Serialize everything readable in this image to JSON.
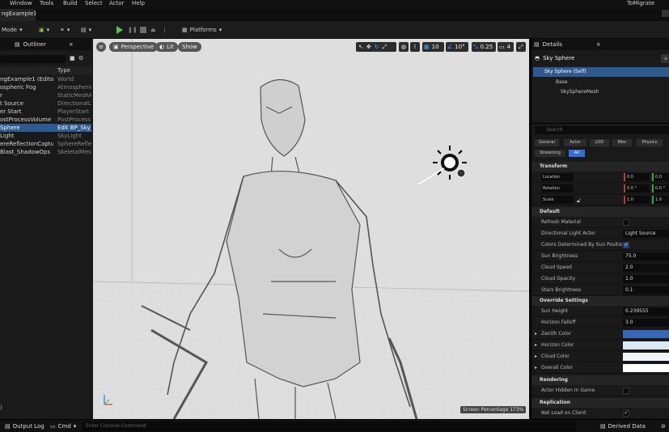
{
  "menu": [
    "Window",
    "Tools",
    "Build",
    "Select",
    "Actor",
    "Help"
  ],
  "project_label": "ToMigrate",
  "doc_tab": "ngExample1•",
  "toolbar": {
    "mode_label": "Mode",
    "platforms_label": "Platforms"
  },
  "outliner": {
    "title": "Outliner",
    "col_type": "Type",
    "rows": [
      {
        "name": "ngExample1 (Editor)",
        "type": "World"
      },
      {
        "name": "ospheric Fog",
        "type": "Atmospheric"
      },
      {
        "name": "r",
        "type": "StaticMeshAc"
      },
      {
        "name": "t Source",
        "type": "DirectionalLi"
      },
      {
        "name": "er Start",
        "type": "PlayerStart"
      },
      {
        "name": "ostProcessVolume",
        "type": "PostProcess"
      },
      {
        "name": "Sphere",
        "type": "Edit BP_Sky_",
        "selected": true
      },
      {
        "name": "Light",
        "type": "SkyLight"
      },
      {
        "name": "ereReflectionCapture",
        "type": "SphereReflec"
      },
      {
        "name": "Blast_ShadowOps",
        "type": "SkeletalMes"
      }
    ],
    "footer": ")"
  },
  "viewport": {
    "perspective": "Perspective",
    "lit": "Lit",
    "show": "Show",
    "grid_snap": "10",
    "rot_snap": "10°",
    "scale_snap": "0.25",
    "cam_speed": "4",
    "screen_percentage": "Screen Percentage  173%"
  },
  "details": {
    "title": "Details",
    "actor_name": "Sky Sphere",
    "components": [
      "Sky Sphere (Self)",
      "Base",
      "SkySphereMesh"
    ],
    "search_placeholder": "Search",
    "filter_tabs": [
      "General",
      "Actor",
      "LOD",
      "Misc",
      "Physics",
      "Streaming",
      "All"
    ],
    "transform": {
      "section": "Transform",
      "location": "Location",
      "rotation": "Rotation",
      "scale": "Scale",
      "loc_x": "0.0",
      "loc_y": "0.0",
      "rot_x": "0.0 °",
      "rot_y": "0.0 °",
      "scale_x": "1.0",
      "scale_y": "1.0"
    },
    "default_section": "Default",
    "properties": [
      {
        "label": "Refresh Material",
        "kind": "check",
        "checked": false
      },
      {
        "label": "Directional Light Actor",
        "kind": "value",
        "value": "Light Source"
      },
      {
        "label": "Colors Determined By Sun Position",
        "kind": "check",
        "checked": true
      },
      {
        "label": "Sun Brightness",
        "kind": "value",
        "value": "75.0"
      },
      {
        "label": "Cloud Speed",
        "kind": "value",
        "value": "2.0"
      },
      {
        "label": "Cloud Opacity",
        "kind": "value",
        "value": "1.0"
      },
      {
        "label": "Stars Brightness",
        "kind": "value",
        "value": "0.1"
      }
    ],
    "override_section": "Override Settings",
    "override_props": [
      {
        "label": "Sun Height",
        "kind": "value",
        "value": "0.239555"
      },
      {
        "label": "Horizon Falloff",
        "kind": "value",
        "value": "3.0"
      },
      {
        "label": "Zenith Color",
        "kind": "color",
        "color": "#3a64b4"
      },
      {
        "label": "Horizon Color",
        "kind": "color",
        "color": "#dce8f2"
      },
      {
        "label": "Cloud Color",
        "kind": "color",
        "color": "#f0f3f7"
      },
      {
        "label": "Overall Color",
        "kind": "color",
        "color": "#ffffff"
      }
    ],
    "rendering_section": "Rendering",
    "actor_hidden_label": "Actor Hidden In Game",
    "replication_section": "Replication",
    "net_load_label": "Net Load on Client"
  },
  "bottom": {
    "output_log": "Output Log",
    "cmd": "Cmd",
    "console_placeholder": "Enter Console Command",
    "derived_data": "Derived Data"
  }
}
